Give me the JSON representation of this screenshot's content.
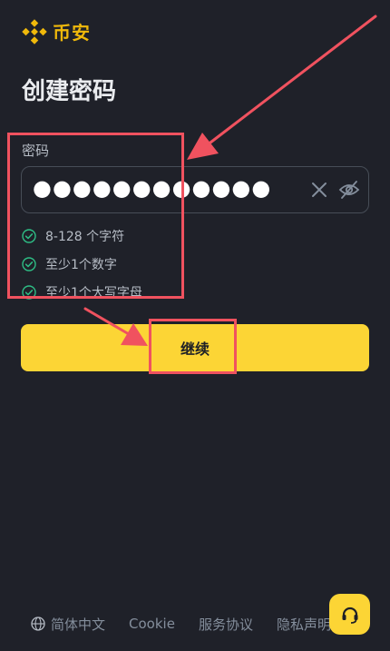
{
  "brand": {
    "name": "币安",
    "color": "#f0b90b"
  },
  "page": {
    "title": "创建密码"
  },
  "password": {
    "label": "密码",
    "masked_value": "●●●●●●●●●●●●",
    "icons": [
      "clear-icon",
      "eye-off-icon"
    ]
  },
  "rules": [
    {
      "text": "8-128 个字符",
      "met": true
    },
    {
      "text": "至少1个数字",
      "met": true
    },
    {
      "text": "至少1个大写字母",
      "met": true
    }
  ],
  "actions": {
    "continue_label": "继续",
    "accent": "#fcd535"
  },
  "footer": {
    "language": "简体中文",
    "cookie": "Cookie",
    "terms": "服务协议",
    "privacy": "隐私声明"
  },
  "annotations": {
    "color": "#f0525f"
  }
}
